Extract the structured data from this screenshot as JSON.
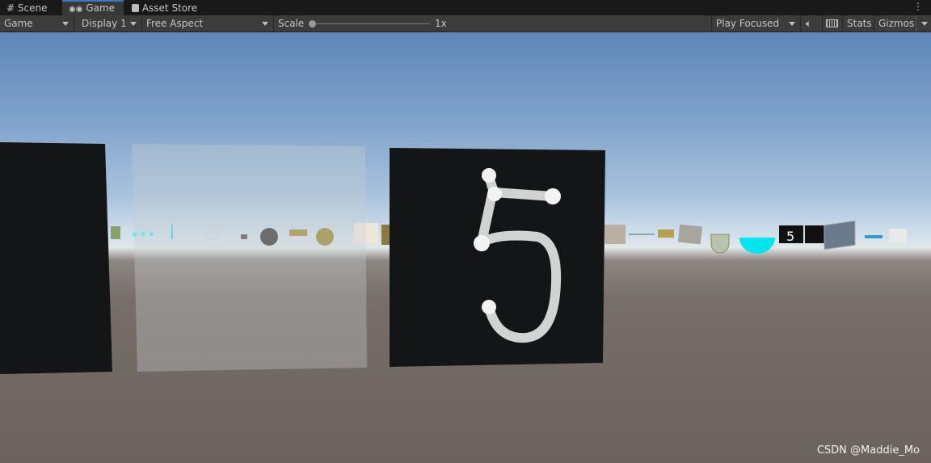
{
  "tabs": [
    {
      "label": "Scene",
      "icon": "grid-icon"
    },
    {
      "label": "Game",
      "icon": "gamepad-icon",
      "active": true
    },
    {
      "label": "Asset Store",
      "icon": "bag-icon"
    }
  ],
  "toolbar": {
    "view_mode": "Game",
    "display": "Display 1",
    "aspect": "Free Aspect",
    "scale_label": "Scale",
    "scale_value": "1x",
    "scale_fraction": 0,
    "play_mode": "Play Focused",
    "stats": "Stats",
    "gizmos": "Gizmos"
  },
  "scene": {
    "digit": "5"
  },
  "watermark": "CSDN @Maddie_Mo",
  "colors": {
    "tab_accent": "#3a79bb",
    "toolbar": "#3c3c3c",
    "panel": "#141516"
  }
}
